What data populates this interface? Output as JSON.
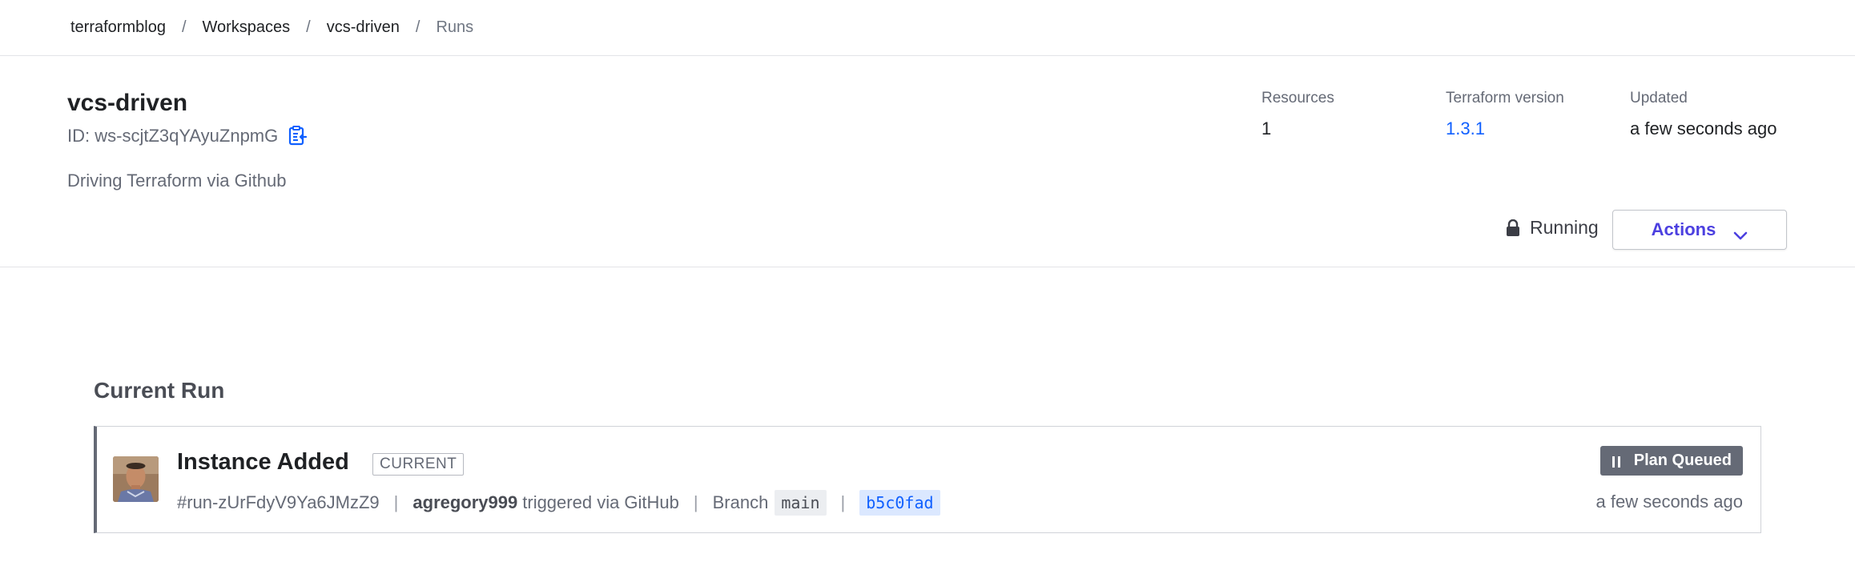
{
  "breadcrumb": {
    "items": [
      {
        "label": "terraformblog"
      },
      {
        "label": "Workspaces"
      },
      {
        "label": "vcs-driven"
      }
    ],
    "current": "Runs",
    "separator": "/"
  },
  "workspace": {
    "name": "vcs-driven",
    "id_text": "ID: ws-scjtZ3qYAyuZnpmG",
    "description": "Driving Terraform via Github",
    "stats": {
      "resources": {
        "label": "Resources",
        "value": "1"
      },
      "terraform_version": {
        "label": "Terraform version",
        "value": "1.3.1"
      },
      "updated": {
        "label": "Updated",
        "value": "a few seconds ago"
      }
    },
    "lock_status": "Running",
    "actions_label": "Actions"
  },
  "current_run": {
    "section_title": "Current Run",
    "title": "Instance Added",
    "badge": "CURRENT",
    "run_id": "#run-zUrFdyV9Ya6JMzZ9",
    "user": "agregory999",
    "trigger_text": "triggered via GitHub",
    "branch_label": "Branch",
    "branch": "main",
    "commit": "b5c0fad",
    "status": "Plan Queued",
    "time": "a few seconds ago",
    "meta_separator": "|"
  },
  "colors": {
    "link": "#1060ff",
    "actions": "#4c40e0",
    "status_badge_bg": "#656a76",
    "card_accent": "#656a76"
  },
  "icons": [
    "copy-clipboard-icon",
    "lock-icon",
    "chevron-down-icon",
    "pause-icon"
  ]
}
